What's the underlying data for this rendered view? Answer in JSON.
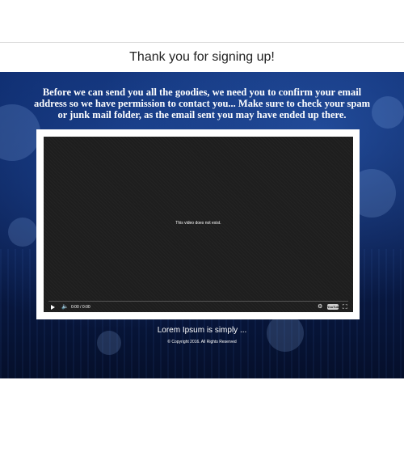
{
  "header": {
    "title": "Thank you for signing up!"
  },
  "hero": {
    "message": "Before we can send you all the goodies, we need you to confirm your email address so we have permission to contact you... Make sure to check your spam or junk mail folder, as the email sent you may have ended up there.",
    "caption": "Lorem Ipsum is simply ...",
    "copyright": "© Copyright 2016. All Rights Reserved"
  },
  "video": {
    "error_text": "This video does not exist.",
    "time": "0:00 / 0:00",
    "play_icon": "play-icon",
    "volume_icon": "volume-icon",
    "settings_icon": "gear-icon",
    "youtube_label": "YouTube",
    "fullscreen_icon": "fullscreen-icon"
  },
  "colors": {
    "hero_background": "#0d2a6b",
    "player_background": "#1e1e1e",
    "text_light": "#ffffff"
  }
}
